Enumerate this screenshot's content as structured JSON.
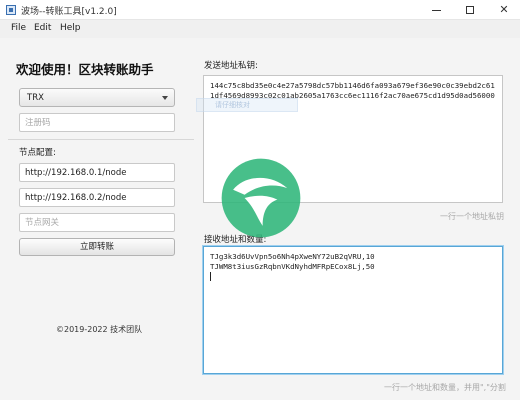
{
  "window": {
    "title": "波场--转账工具[v1.2.0]",
    "icon": "app-window-icon",
    "controls": [
      "minimize-icon",
      "maximize-icon",
      "close-icon"
    ],
    "close_glyph": "✕"
  },
  "menu": {
    "file": "File",
    "edit": "Edit",
    "help": "Help"
  },
  "left": {
    "app_title": "欢迎使用！区块转账助手",
    "token_select": {
      "value": "TRX"
    },
    "reg_code": {
      "placeholder": "注册码",
      "value": ""
    },
    "node_section_label": "节点配置:",
    "node1": {
      "value": "http://192.168.0.1/node"
    },
    "node2": {
      "value": "http://192.168.0.2/node"
    },
    "gateway": {
      "placeholder": "节点网关",
      "value": ""
    },
    "transfer_button": "立即转账",
    "copyright": "©2019-2022 技术团队"
  },
  "right": {
    "send_label": "发送地址私钥:",
    "send_keys": "144c75c8bd35e0c4e27a5798dc57bb1146d6fa093a679ef36e90c0c39ebd2c611df4569d8993c02c01ab2605a1763cc6ec1116f2ac70ae675cd1d95d0ad56000",
    "send_hint": "一行一个地址私钥",
    "tip_overlay_text": "请仔细核对",
    "recv_label": "接收地址和数量:",
    "recv_lines": "TJg3k3d6UvVpn5o6Nh4pXweNY72uB2qVRU,10\nTJWM8t3iusGzRqbnVKdNyhdMFRpECox8Lj,50\n",
    "recv_hint": "一行一个地址和数量，并用\",\"分割"
  },
  "colors": {
    "watermark_green": "#2fb67a",
    "focus_border": "#58a6d6"
  },
  "watermark": {
    "icon": "brand-watermark-logo"
  }
}
